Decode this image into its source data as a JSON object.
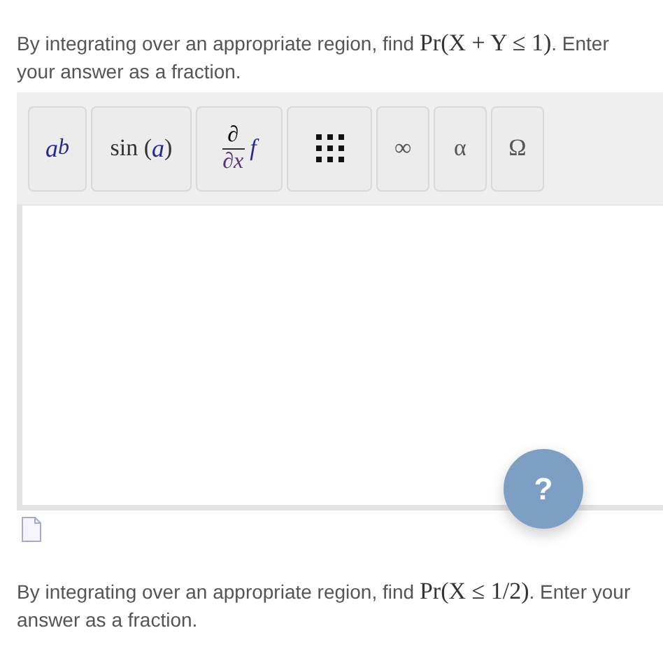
{
  "questions": [
    {
      "text_before": "By integrating over an appropriate region, find ",
      "math": "Pr(X + Y ≤ 1)",
      "text_after": ". Enter your answer as a fraction."
    },
    {
      "text_before": "By integrating over an appropriate region, find ",
      "math": "Pr(X ≤ 1/2)",
      "text_after": ". Enter your answer as a fraction."
    }
  ],
  "toolbar": [
    {
      "kind": "power",
      "base": "a",
      "exponent": "b"
    },
    {
      "kind": "function",
      "name": "sin",
      "open": "(",
      "argument": "a",
      "close": ")"
    },
    {
      "kind": "derivative",
      "numerator": "∂",
      "denominator": "∂x",
      "operand": "f"
    },
    {
      "kind": "matrix"
    },
    {
      "kind": "symbol",
      "symbol": "∞"
    },
    {
      "kind": "symbol",
      "symbol": "α"
    },
    {
      "kind": "symbol",
      "symbol": "Ω"
    }
  ],
  "help_button": {
    "label": "?"
  }
}
